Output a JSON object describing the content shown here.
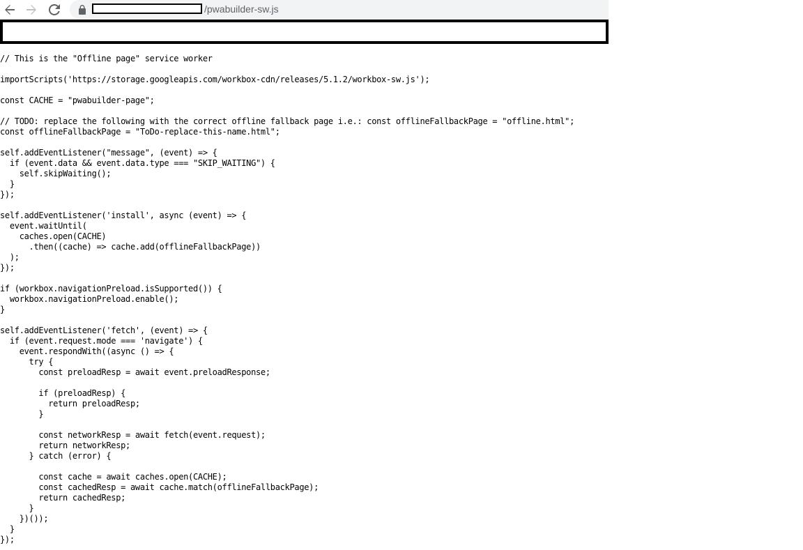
{
  "browser": {
    "url_path": "/pwabuilder-sw.js",
    "icons": {
      "back": "arrow-left-icon",
      "forward": "arrow-right-icon",
      "reload": "reload-icon",
      "lock": "lock-icon"
    }
  },
  "source": {
    "code": "// This is the \"Offline page\" service worker\n\nimportScripts('https://storage.googleapis.com/workbox-cdn/releases/5.1.2/workbox-sw.js');\n\nconst CACHE = \"pwabuilder-page\";\n\n// TODO: replace the following with the correct offline fallback page i.e.: const offlineFallbackPage = \"offline.html\";\nconst offlineFallbackPage = \"ToDo-replace-this-name.html\";\n\nself.addEventListener(\"message\", (event) => {\n  if (event.data && event.data.type === \"SKIP_WAITING\") {\n    self.skipWaiting();\n  }\n});\n\nself.addEventListener('install', async (event) => {\n  event.waitUntil(\n    caches.open(CACHE)\n      .then((cache) => cache.add(offlineFallbackPage))\n  );\n});\n\nif (workbox.navigationPreload.isSupported()) {\n  workbox.navigationPreload.enable();\n}\n\nself.addEventListener('fetch', (event) => {\n  if (event.request.mode === 'navigate') {\n    event.respondWith((async () => {\n      try {\n        const preloadResp = await event.preloadResponse;\n\n        if (preloadResp) {\n          return preloadResp;\n        }\n\n        const networkResp = await fetch(event.request);\n        return networkResp;\n      } catch (error) {\n\n        const cache = await caches.open(CACHE);\n        const cachedResp = await cache.match(offlineFallbackPage);\n        return cachedResp;\n      }\n    })());\n  }\n});"
  }
}
